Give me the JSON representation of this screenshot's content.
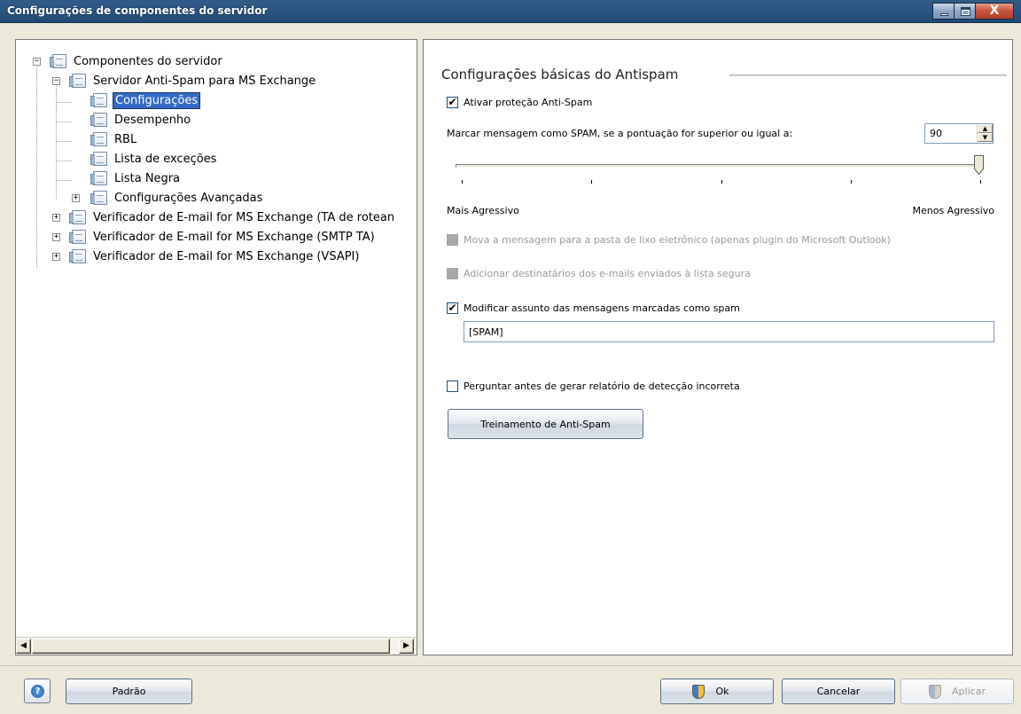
{
  "window": {
    "title": "Configurações de componentes do servidor",
    "close_glyph": "X"
  },
  "tree": {
    "root": "Componentes do servidor",
    "anti_spam": "Servidor Anti-Spam para MS Exchange",
    "children": [
      "Configurações",
      "Desempenho",
      "RBL",
      "Lista de exceções",
      "Lista Negra",
      "Configurações Avançadas"
    ],
    "verifier_ta": "Verificador de E-mail for MS Exchange (TA de rotean",
    "verifier_smtp": "Verificador de E-mail for MS Exchange (SMTP TA)",
    "verifier_vsapi": "Verificador de E-mail for MS Exchange (VSAPI)",
    "selected": "Configurações"
  },
  "panel": {
    "title": "Configurações básicas do Antispam",
    "enable_antispam": {
      "label": "Ativar proteção Anti-Spam",
      "checked": true
    },
    "threshold_label": "Marcar mensagem como SPAM, se a pontuação for superior ou igual a:",
    "threshold_value": "90",
    "slider": {
      "left_label": "Mais Agressivo",
      "right_label": "Menos Agressivo",
      "level": 1.0
    },
    "move_junk": {
      "label": "Mova a mensagem para a pasta de lixo eletrônico (apenas plugin do Microsoft Outlook)",
      "checked": false,
      "enabled": false
    },
    "add_recipients": {
      "label": "Adicionar destinatários dos e-mails enviados à lista segura",
      "checked": false,
      "enabled": false
    },
    "modify_subject": {
      "label": "Modificar assunto das mensagens marcadas como spam",
      "checked": true
    },
    "subject_tag": "[SPAM]",
    "ask_report": {
      "label": "Perguntar antes de gerar relatório de detecção incorreta",
      "checked": false
    },
    "training_button": "Treinamento de Anti-Spam"
  },
  "footer": {
    "help_glyph": "?",
    "default_button": "Padrão",
    "ok_button": "Ok",
    "cancel_button": "Cancelar",
    "apply_button": "Aplicar"
  },
  "glyphs": {
    "check": "✔",
    "plus": "+",
    "minus": "−",
    "arrow_left": "◀",
    "arrow_right": "▶",
    "arrow_up": "▲",
    "arrow_down": "▼"
  }
}
